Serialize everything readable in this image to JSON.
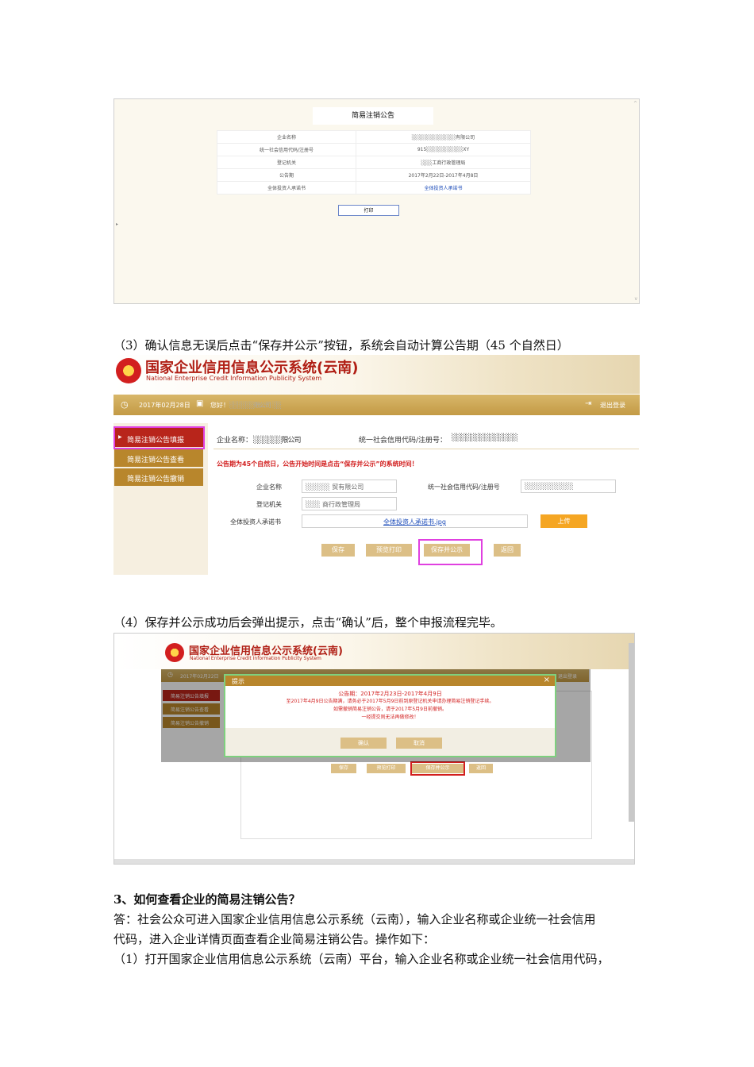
{
  "shot1": {
    "header": "简易注销公告",
    "rows": [
      {
        "label": "企业名称",
        "value": "░░░░░░░░░░░░有限公司"
      },
      {
        "label": "统一社会信用代码/注册号",
        "value": "915░░░░░░░░░░XY"
      },
      {
        "label": "登记机关",
        "value": "░░░工商行政管理局"
      },
      {
        "label": "公告期",
        "value": "2017年2月22日-2017年4月8日"
      },
      {
        "label": "全体投资人承诺书",
        "value": "全体投资人承诺书"
      }
    ],
    "print_label": "打印"
  },
  "step3": "（3）确认信息无误后点击“保存并公示”按钮，系统会自动计算公告期（45 个自然日）",
  "shot2": {
    "title_cn": "国家企业信用信息公示系统(云南)",
    "title_en": "National Enterprise Credit Information Publicity System",
    "date": "2017年02月28日",
    "greeting": "您好！",
    "greeting_company": "░░░░░░限公司",
    "greeting_tail": "░░",
    "logout": "退出登录",
    "sidebar": [
      "简易注销公告填报",
      "简易注销公告查看",
      "简易注销公告撤销"
    ],
    "company_label": "企业名称：",
    "company_value": "░░░░░░限公司",
    "code_label": "统一社会信用代码/注册号：",
    "code_value": "░░░░░░░░░░░░░░",
    "notice": "公告期为45个自然日，公告开始时间是点击“保存并公示”的系统时间！",
    "form": {
      "name_label": "企业名称",
      "name_value": "░░░░░ 贸有限公司",
      "code_label": "统一社会信用代码/注册号",
      "code_value": "░░░░░░░░░░",
      "authority_label": "登记机关",
      "authority_value": "░░░ 商行政管理局",
      "letter_label": "全体投资人承诺书",
      "letter_file": "全体投资人承诺书.jpg",
      "upload": "上传"
    },
    "buttons": [
      "保存",
      "预览打印",
      "保存并公示",
      "返回"
    ]
  },
  "step4": "（4）保存并公示成功后会弹出提示，点击“确认”后，整个申报流程完毕。",
  "shot3": {
    "title_cn": "国家企业信用信息公示系统(云南)",
    "title_en": "National Enterprise Credit Information Publicity System",
    "date": "2017年02月22日",
    "logout": "退出登录",
    "sidebar": [
      "简易注销公告填报",
      "简易注销公告查看",
      "简易注销公告撤销"
    ],
    "dialog_title": "提示",
    "dialog_close": "×",
    "dialog_lines": [
      "公告期：2017年2月23日-2017年4月9日",
      "至2017年4月9日公告期满，请务必于2017年5月9日前到原登记机关申请办理简易注销登记手续。",
      "如需撤销简易注销公告，请于2017年5月9日前撤销。",
      "一经提交则无法再做修改！"
    ],
    "confirm": "确认",
    "cancel": "取消",
    "buttons": [
      "保存",
      "预览打印",
      "保存并公示",
      "返回"
    ]
  },
  "section3_title": "3、如何查看企业的简易注销公告？",
  "answer_line1": "答：社会公众可进入国家企业信用信息公示系统（云南），输入企业名称或企业统一社会信用",
  "answer_line2": "代码，进入企业详情页面查看企业简易注销公告。操作如下：",
  "step1": "（1）打开国家企业信用信息公示系统（云南）平台，输入企业名称或企业统一社会信用代码，"
}
